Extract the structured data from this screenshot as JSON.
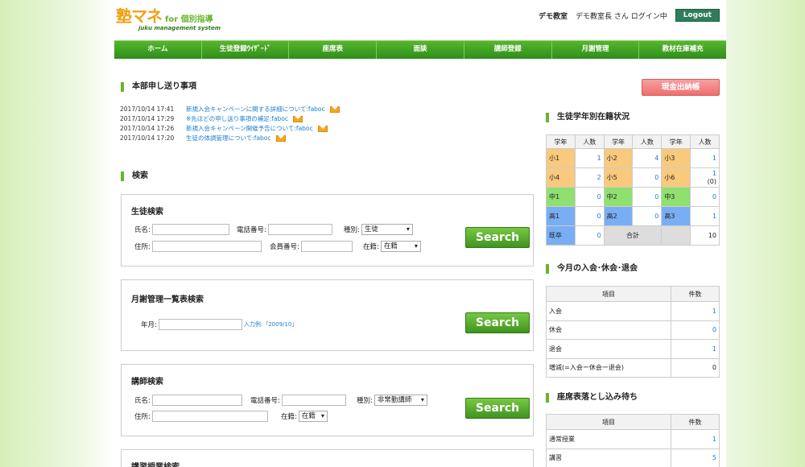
{
  "header": {
    "logo_main": "塾マネ",
    "logo_for": "for 個別指導",
    "logo_sub": "juku management system",
    "school": "デモ教室",
    "user_text": "デモ教室長 さん ログイン中",
    "logout": "Logout"
  },
  "nav": [
    "ホーム",
    "生徒登録ｳｲｻﾞｰﾄﾞ",
    "座席表",
    "面談",
    "講師登録",
    "月謝管理",
    "教材在庫補充"
  ],
  "notices": {
    "title": "本部申し送り事項",
    "items": [
      {
        "ts": "2017/10/14 17:41",
        "text": "新規入会キャンペーンに関する詳細について:faboc"
      },
      {
        "ts": "2017/10/14 17:29",
        "text": "※先ほどの申し送り事項の補足:faboc"
      },
      {
        "ts": "2017/10/14 17:26",
        "text": "新規入会キャンペーン開催予告について:faboc"
      },
      {
        "ts": "2017/10/14 17:20",
        "text": "生徒の体調管理について:faboc"
      }
    ]
  },
  "search": {
    "title": "検索",
    "button": "Search",
    "student": {
      "title": "生徒検索",
      "name_label": "氏名:",
      "phone_label": "電話番号:",
      "type_label": "種別:",
      "type_value": "生徒",
      "address_label": "住所:",
      "member_label": "会員番号:",
      "status_label": "在籍:",
      "status_value": "在籍"
    },
    "fee": {
      "title": "月謝管理一覧表検索",
      "ym_label": "年月:",
      "hint": "入力例:「2009/10」"
    },
    "teacher": {
      "title": "講師検索",
      "name_label": "氏名:",
      "phone_label": "電話番号:",
      "type_label": "種別:",
      "type_value": "非常勤講師",
      "address_label": "住所:",
      "status_label": "在籍:",
      "status_value": "在籍"
    },
    "lecture": {
      "title": "講習授業検索"
    }
  },
  "cash_button": "現金出納帳",
  "grade_status": {
    "title": "生徒学年別在籍状況",
    "headers": [
      "学年",
      "人数",
      "学年",
      "人数",
      "学年",
      "人数"
    ],
    "rows": [
      [
        {
          "g": "小1",
          "n": "1",
          "c": "o"
        },
        {
          "g": "小2",
          "n": "4",
          "c": "o"
        },
        {
          "g": "小3",
          "n": "1",
          "c": "o"
        }
      ],
      [
        {
          "g": "小4",
          "n": "2",
          "c": "o"
        },
        {
          "g": "小5",
          "n": "0",
          "c": "o"
        },
        {
          "g": "小6",
          "n": "1",
          "n2": "(0)",
          "c": "o"
        }
      ],
      [
        {
          "g": "中1",
          "n": "0",
          "c": "g"
        },
        {
          "g": "中2",
          "n": "0",
          "c": "g"
        },
        {
          "g": "中3",
          "n": "0",
          "c": "g"
        }
      ],
      [
        {
          "g": "高1",
          "n": "0",
          "c": "b"
        },
        {
          "g": "高2",
          "n": "0",
          "c": "b"
        },
        {
          "g": "高3",
          "n": "1",
          "c": "b"
        }
      ]
    ],
    "last": {
      "g": "既卒",
      "n": "0",
      "total_label": "合計",
      "total": "10"
    }
  },
  "monthly": {
    "title": "今月の入会･休会･退会",
    "headers": [
      "項目",
      "件数"
    ],
    "rows": [
      {
        "label": "入会",
        "n": "1"
      },
      {
        "label": "休会",
        "n": "0"
      },
      {
        "label": "退会",
        "n": "1"
      },
      {
        "label": "増減(=入会ー休会ー退会)",
        "n": "0"
      }
    ]
  },
  "seating": {
    "title": "座席表落とし込み待ち",
    "headers": [
      "項目",
      "件数"
    ],
    "rows": [
      {
        "label": "通常授業",
        "n": "1"
      },
      {
        "label": "講習",
        "n": "5"
      }
    ]
  },
  "colors": {
    "accent": "#6ab42d",
    "nav_top": "#56b62e",
    "nav_bottom": "#2f8d1a",
    "link": "#1a7fd0",
    "elementary": "#f9c97d",
    "junior": "#8fe06f",
    "high": "#79aef5",
    "cash": "#ee6f6f"
  },
  "icons": {
    "notice": "mail-icon"
  }
}
